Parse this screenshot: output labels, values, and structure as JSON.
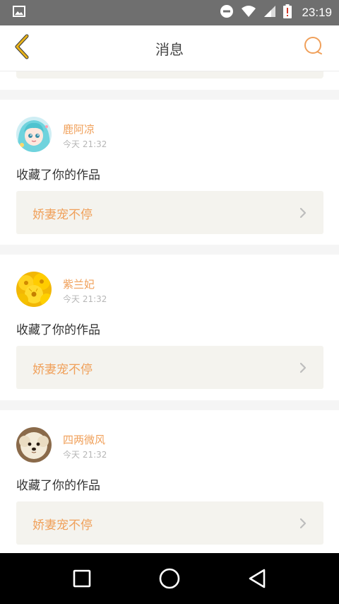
{
  "status_bar": {
    "time": "23:19",
    "icons": [
      "image-notification-icon",
      "do-not-disturb-icon",
      "wifi-icon",
      "signal-icon",
      "battery-alert-icon"
    ]
  },
  "header": {
    "title": "消息",
    "back_icon": "chevron-left-icon",
    "search_icon": "search-icon"
  },
  "messages": [
    {
      "user": "鹿阿凉",
      "time": "今天 21:32",
      "action": "收藏了你的作品",
      "work_title": "娇妻宠不停",
      "avatar": "anime-girl-avatar"
    },
    {
      "user": "紫兰妃",
      "time": "今天 21:32",
      "action": "收藏了你的作品",
      "work_title": "娇妻宠不停",
      "avatar": "yellow-flowers-avatar"
    },
    {
      "user": "四两微风",
      "time": "今天 21:32",
      "action": "收藏了你的作品",
      "work_title": "娇妻宠不停",
      "avatar": "white-puppy-avatar"
    }
  ],
  "colors": {
    "accent": "#f0a05a",
    "back_icon": "#e8b21a",
    "card_bg": "#f4f3ee",
    "divider": "#f5f5f5",
    "status_bar": "#6f6f6f"
  },
  "nav_bar": {
    "buttons": [
      "recent-apps",
      "home",
      "back"
    ]
  }
}
